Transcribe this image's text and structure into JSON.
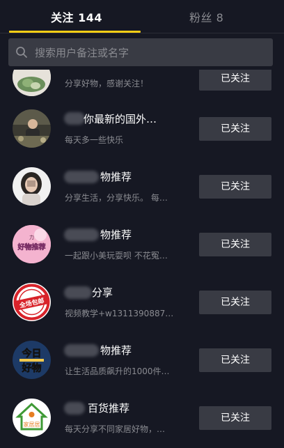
{
  "tabs": {
    "following": "关注 144",
    "fans": "粉丝 8"
  },
  "search": {
    "placeholder": "搜索用户备注或名字"
  },
  "items": [
    {
      "name": "",
      "desc": "分享好物，感谢关注！",
      "button": "已关注"
    },
    {
      "name": "你最新的国外…",
      "desc": "每天多一些快乐",
      "button": "已关注"
    },
    {
      "name": "物推荐",
      "desc": "分享生活，分享快乐。 每…",
      "button": "已关注"
    },
    {
      "name": "物推荐",
      "desc": "一起跟小美玩耍呗 不花冤…",
      "button": "已关注"
    },
    {
      "name": "分享",
      "desc": "视频教学+w1311390887…",
      "button": "已关注"
    },
    {
      "name": "物推荐",
      "desc": "让生活品质飙升的1000件…",
      "button": "已关注"
    },
    {
      "name": "百货推荐",
      "desc": "每天分享不同家居好物，…",
      "button": "已关注"
    }
  ],
  "avatars": {
    "item4_text": "好物推荐",
    "item5_text": "全场包邮",
    "item6_text_top": "今日",
    "item6_text_bottom": "好物",
    "item7_text": "家居居"
  },
  "colors": {
    "background": "#161823",
    "accent": "#face15",
    "button_bg": "#393b44",
    "muted_text": "#8a8b91"
  }
}
